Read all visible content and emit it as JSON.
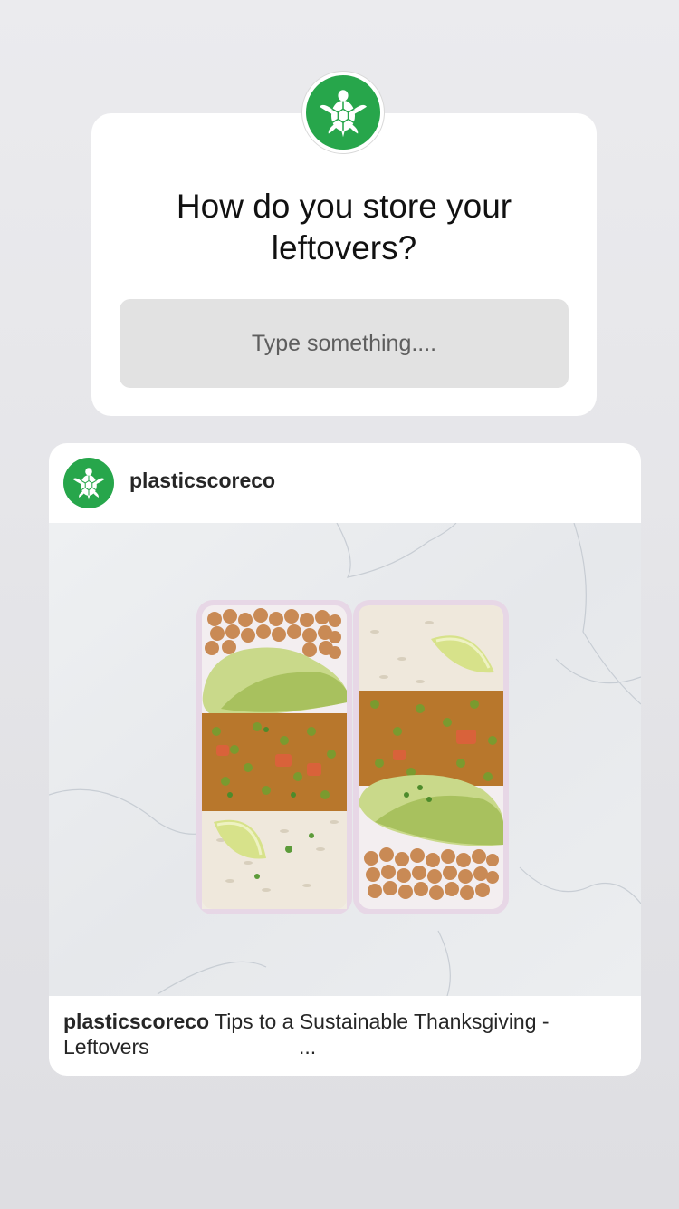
{
  "question_sticker": {
    "prompt": "How do you store your leftovers?",
    "input_placeholder": "Type something....",
    "avatar_icon": "turtle-logo-icon"
  },
  "shared_post": {
    "username": "plasticscoreco",
    "avatar_icon": "turtle-logo-icon",
    "caption_user": "plasticscoreco",
    "caption_text": "Tips to a Sustainable Thanksgiving - Leftovers",
    "caption_more": "...",
    "image_icon": "meal-prep-containers-photo"
  },
  "colors": {
    "brand_green": "#27a64b",
    "background": "#e6e6ea",
    "card": "#ffffff",
    "input_bg": "#e2e2e2"
  }
}
